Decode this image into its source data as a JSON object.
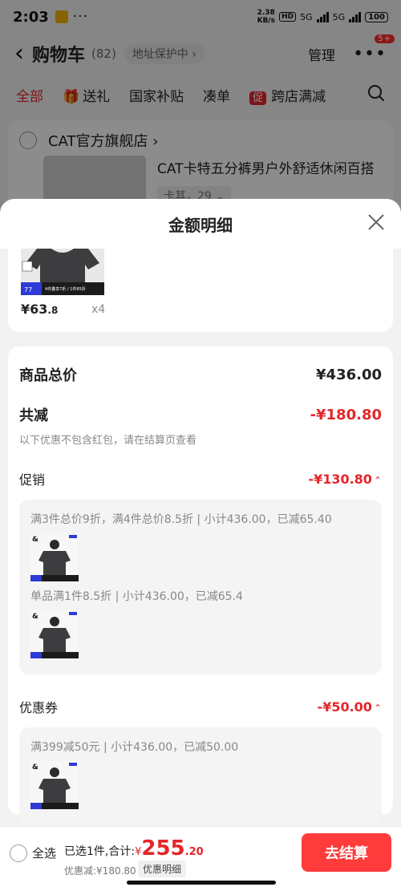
{
  "status": {
    "time": "2:03",
    "more": "···",
    "speed_top": "2.38",
    "speed_bottom": "KB/s",
    "hd": "HD",
    "net1": "5G",
    "net2": "5G",
    "battery": "100"
  },
  "nav": {
    "back": "‹",
    "title": "购物车",
    "count": "(82)",
    "address": "地址保护中 ›",
    "manage": "管理",
    "more": "•••",
    "badge": "5+"
  },
  "tabs": {
    "all": "全部",
    "gift_icon": "🎁",
    "gift": "送礼",
    "subsidy": "国家补贴",
    "bundle": "凑单",
    "promo_tag": "促",
    "cross_store": "跨店满减"
  },
  "store": {
    "name": "CAT官方旗舰店 ›",
    "product_title": "CAT卡特五分裤男户外舒适休闲百搭",
    "product_spec": "卡其，29 ⌄"
  },
  "sheet": {
    "title": "金额明细",
    "item_price_int": "¥63",
    "item_price_dec": ".8",
    "item_qty": "x4",
    "total_label": "商品总价",
    "total_value": "¥436.00",
    "reduce_label": "共减",
    "reduce_value": "-¥180.80",
    "note": "以下优惠不包含红包，请在结算页查看",
    "promo_label": "促销",
    "promo_value": "-¥130.80",
    "promo_line1": "满3件总价9折，满4件总价8.5折 | 小计436.00，已减65.40",
    "promo_line2": "单品满1件8.5折 | 小计436.00，已减65.4",
    "coupon_label": "优惠券",
    "coupon_value": "-¥50.00",
    "coupon_line1": "满399减50元 | 小计436.00，已减50.00",
    "caret": "⌃"
  },
  "bottom": {
    "select_all": "全选",
    "summary_prefix": "已选1件,合计:",
    "yen": "¥",
    "price_int": "255",
    "price_dec": ".20",
    "discount": "优惠减:¥180.80",
    "detail_button": "优惠明细",
    "checkout": "去结算"
  },
  "colors": {
    "accent_red": "#e4262a",
    "checkout_red": "#ff3b3b"
  },
  "thumbnail_badges": {
    "badge_num": "77",
    "badge_text": "4件叠享7折 / 1件85折"
  }
}
